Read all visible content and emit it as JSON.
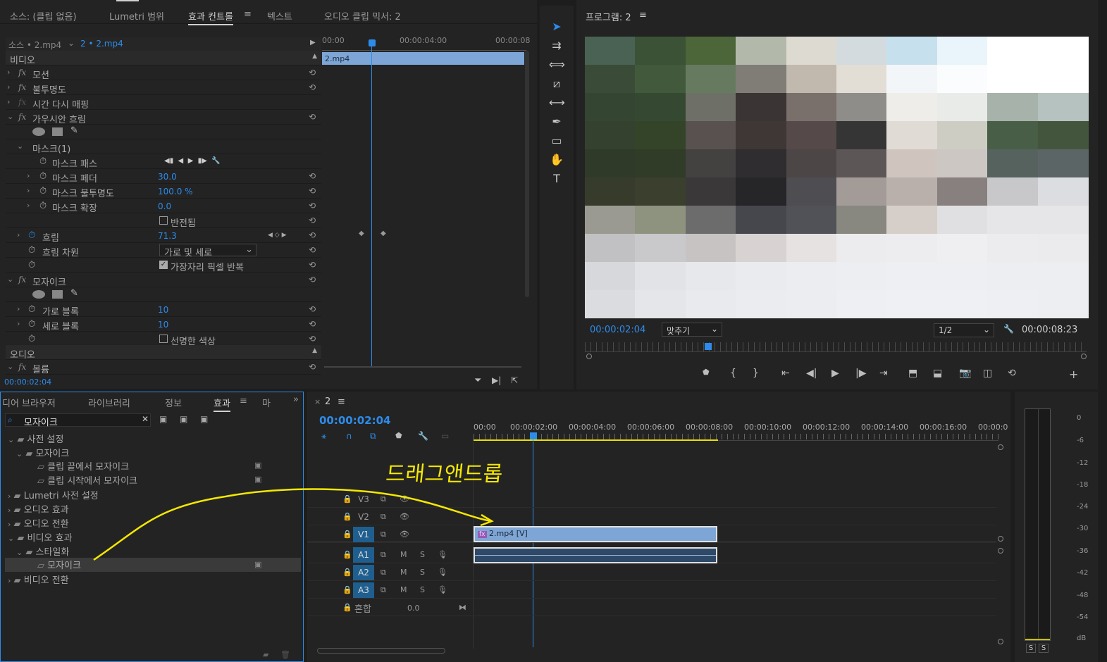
{
  "effect_controls": {
    "tabs": [
      "소스: (클립 없음)",
      "Lumetri 범위",
      "효과 컨트롤",
      "텍스트",
      "오디오 클립 믹서: 2"
    ],
    "source_label": "소스 • 2.mp4",
    "sequence_label": "2 • 2.mp4",
    "video_header": "비디오",
    "audio_header": "오디오",
    "motion": "모션",
    "opacity": "불투명도",
    "time_remap": "시간 다시 매핑",
    "gaussian_blur": "가우시안 흐림",
    "mask": "마스크(1)",
    "mask_path": "마스크 패스",
    "mask_feather": "마스크 페더",
    "mask_feather_val": "30.0",
    "mask_opacity": "마스크 불투명도",
    "mask_opacity_val": "100.0 %",
    "mask_expand": "마스크 확장",
    "mask_expand_val": "0.0",
    "inverted": "반전됨",
    "blur": "흐림",
    "blur_val": "71.3",
    "blur_dim": "흐림 차원",
    "blur_dim_val": "가로 및 세로",
    "repeat_edge": "가장자리 픽셀 반복",
    "mosaic": "모자이크",
    "h_blocks": "가로 블록",
    "h_blocks_val": "10",
    "v_blocks": "세로 블록",
    "v_blocks_val": "10",
    "sharp_colors": "선명한 색상",
    "volume": "볼륨",
    "timecode": "00:00:02:04",
    "ruler": [
      "00:00",
      "00:00:04:00",
      "00:00:08"
    ],
    "clip": "2.mp4"
  },
  "program": {
    "title": "프로그램: 2",
    "timecode": "00:00:02:04",
    "fit": "맞추기",
    "resolution": "1/2",
    "duration": "00:00:08:23",
    "mosaic_colors": [
      [
        "#4a6254",
        "#3c5237",
        "#4c6539",
        "#b3b9aa",
        "#dddad2",
        "#d3dbdf",
        "#c7e0ed",
        "#e9f4fb",
        "#ffffff",
        "#ffffff"
      ],
      [
        "#3a4b38",
        "#425a3b",
        "#667a5f",
        "#7f7d76",
        "#c1b8ae",
        "#e2ddd5",
        "#f3f6f8",
        "#fafcfd",
        "#ffffff",
        "#ffffff"
      ],
      [
        "#344532",
        "#354932",
        "#6e6f66",
        "#3b3434",
        "#796f6b",
        "#8f8d89",
        "#efedea",
        "#e9ebe9",
        "#a7b2aa",
        "#b6c2bf"
      ],
      [
        "#34412f",
        "#334429",
        "#585150",
        "#3f3736",
        "#55494a",
        "#363535",
        "#e0dbd4",
        "#cdcdc4",
        "#495e47",
        "#43553d"
      ],
      [
        "#2f3a29",
        "#303b28",
        "#444141",
        "#2f2d2f",
        "#4c4746",
        "#5d5657",
        "#d0c5be",
        "#cdc7c4",
        "#55625d",
        "#5c6565"
      ],
      [
        "#373b2c",
        "#3b3f2d",
        "#3a3839",
        "#262629",
        "#4d4d52",
        "#a39b98",
        "#bab0ab",
        "#87807e",
        "#c8c8ca",
        "#dcdde0"
      ],
      [
        "#9b9a92",
        "#8d937e",
        "#6b6c6b",
        "#46474d",
        "#515257",
        "#888880",
        "#d6cfc9",
        "#e0dfe1",
        "#e6e6e8",
        "#e6e6e9"
      ],
      [
        "#c1c1c3",
        "#c9c9cc",
        "#c7c3c2",
        "#d8d3d2",
        "#e5e2e1",
        "#ececee",
        "#ededf0",
        "#efeff1",
        "#ececef",
        "#ebebee"
      ],
      [
        "#d6d8dc",
        "#e1e3e7",
        "#e6e8ec",
        "#e9ebef",
        "#ebedf0",
        "#edeef1",
        "#eeeff2",
        "#eeeff2",
        "#edeef1",
        "#eceef1"
      ],
      [
        "#dadce0",
        "#e4e6ea",
        "#e8eaee",
        "#eaecef",
        "#ecedf0",
        "#eeeff2",
        "#eff0f3",
        "#eff0f3",
        "#eeeff2",
        "#edeef1"
      ]
    ]
  },
  "effects_panel": {
    "tabs": [
      "디어 브라우저",
      "라이브러리",
      "정보",
      "효과",
      "마"
    ],
    "search": "모자이크",
    "items": [
      "사전 설정",
      "모자이크",
      "클립 끝에서 모자이크",
      "클립 시작에서 모자이크",
      "Lumetri 사전 설정",
      "오디오 효과",
      "오디오 전환",
      "비디오 효과",
      "스타일화",
      "모자이크",
      "비디오 전환"
    ]
  },
  "timeline": {
    "tab": "2",
    "timecode": "00:00:02:04",
    "ruler": [
      "00:00",
      "00:00:02:00",
      "00:00:04:00",
      "00:00:06:00",
      "00:00:08:00",
      "00:00:10:00",
      "00:00:12:00",
      "00:00:14:00",
      "00:00:16:00",
      "00:00:0"
    ],
    "tracks_v": [
      "V3",
      "V2",
      "V1"
    ],
    "tracks_a": [
      "A1",
      "A2",
      "A3"
    ],
    "m": "M",
    "s": "S",
    "mix": "혼합",
    "mix_val": "0.0",
    "clip_v": "2.mp4 [V]",
    "clip_fx": "fx",
    "annotation": "드래그앤드롭"
  },
  "meter": {
    "labels": [
      "0",
      "-6",
      "-12",
      "-18",
      "-24",
      "-30",
      "-36",
      "-42",
      "-48",
      "-54",
      "dB"
    ],
    "s": "S"
  }
}
